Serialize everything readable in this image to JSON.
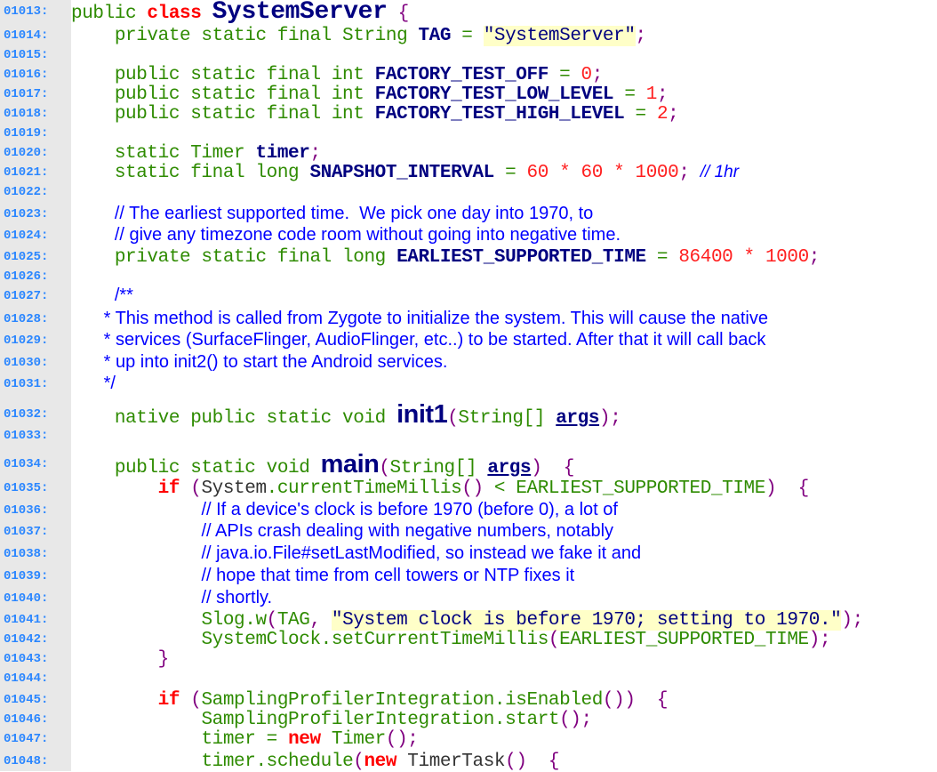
{
  "colors": {
    "line_number": "#2a86ff",
    "keyword": "#2e8b00",
    "reserved": "#ff0000",
    "identifier": "#000080",
    "comment": "#0000ff",
    "string_bg": "#ffffc8",
    "gutter": "#e8e8e8"
  },
  "lines": [
    {
      "n": "01013:",
      "t": [
        [
          "kw",
          "public "
        ],
        [
          "red",
          "class "
        ],
        [
          "big",
          "SystemServer"
        ],
        [
          "pnc",
          " {"
        ]
      ]
    },
    {
      "n": "01014:",
      "t": [
        [
          "ws",
          "    "
        ],
        [
          "kw",
          "private static final String "
        ],
        [
          "id",
          "TAG"
        ],
        [
          "op",
          " = "
        ],
        [
          "str",
          "\"SystemServer\""
        ],
        [
          "pnc",
          ";"
        ]
      ]
    },
    {
      "n": "01015:",
      "t": []
    },
    {
      "n": "01016:",
      "t": [
        [
          "ws",
          "    "
        ],
        [
          "kw",
          "public static final int "
        ],
        [
          "id",
          "FACTORY_TEST_OFF"
        ],
        [
          "op",
          " = "
        ],
        [
          "num",
          "0"
        ],
        [
          "pnc",
          ";"
        ]
      ]
    },
    {
      "n": "01017:",
      "t": [
        [
          "ws",
          "    "
        ],
        [
          "kw",
          "public static final int "
        ],
        [
          "id",
          "FACTORY_TEST_LOW_LEVEL"
        ],
        [
          "op",
          " = "
        ],
        [
          "num",
          "1"
        ],
        [
          "pnc",
          ";"
        ]
      ]
    },
    {
      "n": "01018:",
      "t": [
        [
          "ws",
          "    "
        ],
        [
          "kw",
          "public static final int "
        ],
        [
          "id",
          "FACTORY_TEST_HIGH_LEVEL"
        ],
        [
          "op",
          " = "
        ],
        [
          "num",
          "2"
        ],
        [
          "pnc",
          ";"
        ]
      ]
    },
    {
      "n": "01019:",
      "t": []
    },
    {
      "n": "01020:",
      "t": [
        [
          "ws",
          "    "
        ],
        [
          "kw",
          "static Timer "
        ],
        [
          "id",
          "timer"
        ],
        [
          "pnc",
          ";"
        ]
      ]
    },
    {
      "n": "01021:",
      "t": [
        [
          "ws",
          "    "
        ],
        [
          "kw",
          "static final long "
        ],
        [
          "id",
          "SNAPSHOT_INTERVAL"
        ],
        [
          "op",
          " = "
        ],
        [
          "num",
          "60"
        ],
        [
          "num",
          " * "
        ],
        [
          "num",
          "60"
        ],
        [
          "num",
          " * "
        ],
        [
          "num",
          "1000"
        ],
        [
          "pnc",
          "; "
        ],
        [
          "cmi",
          "// 1hr"
        ]
      ]
    },
    {
      "n": "01022:",
      "t": []
    },
    {
      "n": "01023:",
      "t": [
        [
          "ws",
          "    "
        ],
        [
          "cm",
          "// The earliest supported time.  We pick one day into 1970, to"
        ]
      ]
    },
    {
      "n": "01024:",
      "t": [
        [
          "ws",
          "    "
        ],
        [
          "cm",
          "// give any timezone code room without going into negative time."
        ]
      ]
    },
    {
      "n": "01025:",
      "t": [
        [
          "ws",
          "    "
        ],
        [
          "kw",
          "private static final long "
        ],
        [
          "id",
          "EARLIEST_SUPPORTED_TIME"
        ],
        [
          "op",
          " = "
        ],
        [
          "num",
          "86400"
        ],
        [
          "num",
          " * "
        ],
        [
          "num",
          "1000"
        ],
        [
          "pnc",
          ";"
        ]
      ]
    },
    {
      "n": "01026:",
      "t": []
    },
    {
      "n": "01027:",
      "t": [
        [
          "ws",
          "    "
        ],
        [
          "cm",
          "/**"
        ]
      ]
    },
    {
      "n": "01028:",
      "t": [
        [
          "ws",
          "   "
        ],
        [
          "cm",
          "* This method is called from Zygote to initialize the system. This will cause the native"
        ]
      ]
    },
    {
      "n": "01029:",
      "t": [
        [
          "ws",
          "   "
        ],
        [
          "cm",
          "* services (SurfaceFlinger, AudioFlinger, etc..) to be started. After that it will call back"
        ]
      ]
    },
    {
      "n": "01030:",
      "t": [
        [
          "ws",
          "   "
        ],
        [
          "cm",
          "* up into init2() to start the Android services."
        ]
      ]
    },
    {
      "n": "01031:",
      "t": [
        [
          "ws",
          "   "
        ],
        [
          "cm",
          "*/"
        ]
      ]
    },
    {
      "n": "01032:",
      "t": [
        [
          "ws",
          "    "
        ],
        [
          "kw",
          "native public static void "
        ],
        [
          "bigs",
          "init1"
        ],
        [
          "pnc",
          "("
        ],
        [
          "kw",
          "String[] "
        ],
        [
          "arg",
          "args"
        ],
        [
          "pnc",
          ");"
        ]
      ]
    },
    {
      "n": "01033:",
      "t": []
    },
    {
      "n": "01034:",
      "t": [
        [
          "ws",
          "    "
        ],
        [
          "kw",
          "public static void "
        ],
        [
          "bigs",
          "main"
        ],
        [
          "pnc",
          "("
        ],
        [
          "kw",
          "String[] "
        ],
        [
          "arg",
          "args"
        ],
        [
          "pnc",
          ")  {"
        ]
      ]
    },
    {
      "n": "01035:",
      "t": [
        [
          "ws",
          "        "
        ],
        [
          "red",
          "if "
        ],
        [
          "pnc",
          "("
        ],
        [
          "plain",
          "System"
        ],
        [
          "kw",
          ".currentTimeMillis"
        ],
        [
          "pnc",
          "()"
        ],
        [
          "kw",
          " < EARLIEST_SUPPORTED_TIME"
        ],
        [
          "pnc",
          ")  {"
        ]
      ]
    },
    {
      "n": "01036:",
      "t": [
        [
          "ws",
          "            "
        ],
        [
          "cm",
          "// If a device's clock is before 1970 (before 0), a lot of"
        ]
      ]
    },
    {
      "n": "01037:",
      "t": [
        [
          "ws",
          "            "
        ],
        [
          "cm",
          "// APIs crash dealing with negative numbers, notably"
        ]
      ]
    },
    {
      "n": "01038:",
      "t": [
        [
          "ws",
          "            "
        ],
        [
          "cm",
          "// java.io.File#setLastModified, so instead we fake it and"
        ]
      ]
    },
    {
      "n": "01039:",
      "t": [
        [
          "ws",
          "            "
        ],
        [
          "cm",
          "// hope that time from cell towers or NTP fixes it"
        ]
      ]
    },
    {
      "n": "01040:",
      "t": [
        [
          "ws",
          "            "
        ],
        [
          "cm",
          "// shortly."
        ]
      ]
    },
    {
      "n": "01041:",
      "t": [
        [
          "ws",
          "            "
        ],
        [
          "kw",
          "Slog.w"
        ],
        [
          "pnc",
          "("
        ],
        [
          "kw",
          "TAG"
        ],
        [
          "pnc",
          ", "
        ],
        [
          "str",
          "\"System clock is before 1970; setting to 1970.\""
        ],
        [
          "pnc",
          ");"
        ]
      ]
    },
    {
      "n": "01042:",
      "t": [
        [
          "ws",
          "            "
        ],
        [
          "kw",
          "SystemClock.setCurrentTimeMillis"
        ],
        [
          "pnc",
          "("
        ],
        [
          "kw",
          "EARLIEST_SUPPORTED_TIME"
        ],
        [
          "pnc",
          ");"
        ]
      ]
    },
    {
      "n": "01043:",
      "t": [
        [
          "ws",
          "        "
        ],
        [
          "pnc",
          "}"
        ]
      ]
    },
    {
      "n": "01044:",
      "t": []
    },
    {
      "n": "01045:",
      "t": [
        [
          "ws",
          "        "
        ],
        [
          "red",
          "if "
        ],
        [
          "pnc",
          "("
        ],
        [
          "kw",
          "SamplingProfilerIntegration.isEnabled"
        ],
        [
          "pnc",
          "())  {"
        ]
      ]
    },
    {
      "n": "01046:",
      "t": [
        [
          "ws",
          "            "
        ],
        [
          "kw",
          "SamplingProfilerIntegration.start"
        ],
        [
          "pnc",
          "();"
        ]
      ]
    },
    {
      "n": "01047:",
      "t": [
        [
          "ws",
          "            "
        ],
        [
          "kw",
          "timer = "
        ],
        [
          "red",
          "new "
        ],
        [
          "kw",
          "Timer"
        ],
        [
          "pnc",
          "();"
        ]
      ]
    },
    {
      "n": "01048:",
      "t": [
        [
          "ws",
          "            "
        ],
        [
          "kw",
          "timer.schedule"
        ],
        [
          "pnc",
          "("
        ],
        [
          "red",
          "new "
        ],
        [
          "plain",
          "TimerTask"
        ],
        [
          "pnc",
          "()  {"
        ]
      ]
    }
  ]
}
